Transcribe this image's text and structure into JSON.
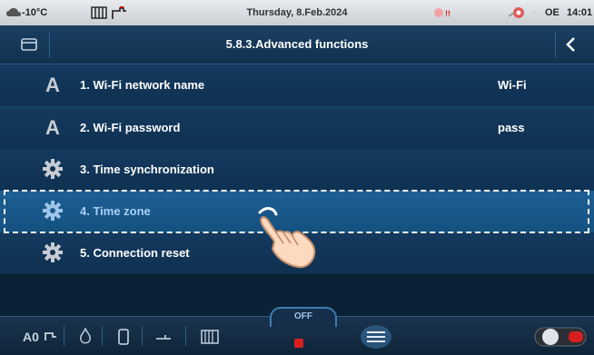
{
  "status": {
    "outdoor_temp": "-10°C",
    "date": "Thursday, 8.Feb.2024",
    "mode_code": "OE",
    "time": "14:01"
  },
  "header": {
    "title": "5.8.3.Advanced functions"
  },
  "menu": [
    {
      "label": "1. Wi-Fi network name",
      "value": "Wi-Fi",
      "icon": "font-A-icon"
    },
    {
      "label": "2. Wi-Fi password",
      "value": "pass",
      "icon": "font-A-icon"
    },
    {
      "label": "3. Time synchronization",
      "value": "",
      "icon": "gear-icon"
    },
    {
      "label": "4. Time zone",
      "value": "",
      "icon": "gear-icon"
    },
    {
      "label": "5. Connection reset",
      "value": "",
      "icon": "gear-icon"
    }
  ],
  "bottom": {
    "off_label": "OFF"
  },
  "colors": {
    "accent": "#3f7cb0",
    "selected_row": "#1d5f95",
    "status_bg": "#e9ecef",
    "alert_red": "#d81f1f"
  }
}
